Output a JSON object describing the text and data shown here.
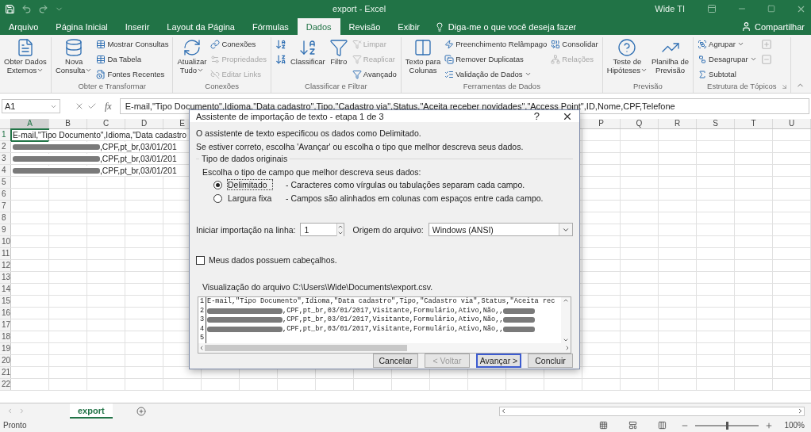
{
  "window": {
    "title": "export - Excel",
    "user": "Wide TI"
  },
  "menu_tabs": [
    {
      "label": "Arquivo",
      "selected": false
    },
    {
      "label": "Página Inicial",
      "selected": false
    },
    {
      "label": "Inserir",
      "selected": false
    },
    {
      "label": "Layout da Página",
      "selected": false
    },
    {
      "label": "Fórmulas",
      "selected": false
    },
    {
      "label": "Dados",
      "selected": true
    },
    {
      "label": "Revisão",
      "selected": false
    },
    {
      "label": "Exibir",
      "selected": false
    }
  ],
  "tell_me": "Diga-me o que você deseja fazer",
  "share": "Compartilhar",
  "ribbon_groups": [
    {
      "columns": [
        [
          {
            "kind": "large",
            "lines": [
              "Obter Dados",
              "Externos"
            ],
            "dropdown": true,
            "disabled": false
          }
        ]
      ]
    },
    {
      "label": "Obter e Transformar",
      "columns": [
        [
          {
            "kind": "large",
            "lines": [
              "Nova",
              "Consulta"
            ],
            "dropdown": true,
            "disabled": false
          }
        ],
        [
          {
            "kind": "small",
            "lines": [
              "Mostrar Consultas"
            ],
            "dropdown": false,
            "disabled": false
          },
          {
            "kind": "small",
            "lines": [
              "Da Tabela"
            ],
            "dropdown": false,
            "disabled": false
          },
          {
            "kind": "small",
            "lines": [
              "Fontes Recentes"
            ],
            "dropdown": false,
            "disabled": false
          }
        ]
      ]
    },
    {
      "label": "Conexões",
      "columns": [
        [
          {
            "kind": "large",
            "lines": [
              "Atualizar",
              "Tudo"
            ],
            "dropdown": true,
            "disabled": false
          }
        ],
        [
          {
            "kind": "small",
            "lines": [
              "Conexões"
            ],
            "dropdown": false,
            "disabled": false
          },
          {
            "kind": "small",
            "lines": [
              "Propriedades"
            ],
            "dropdown": false,
            "disabled": true
          },
          {
            "kind": "small",
            "lines": [
              "Editar Links"
            ],
            "dropdown": false,
            "disabled": true
          }
        ]
      ]
    },
    {
      "label": "Classificar e Filtrar",
      "columns": [
        [
          {
            "kind": "icon",
            "disabled": false
          },
          {
            "kind": "icon",
            "disabled": false
          }
        ],
        [
          {
            "kind": "large",
            "lines": [
              "Classificar"
            ],
            "dropdown": false,
            "disabled": false
          }
        ],
        [
          {
            "kind": "large",
            "lines": [
              "Filtro"
            ],
            "dropdown": false,
            "disabled": false
          }
        ],
        [
          {
            "kind": "small",
            "lines": [
              "Limpar"
            ],
            "dropdown": false,
            "disabled": true
          },
          {
            "kind": "small",
            "lines": [
              "Reaplicar"
            ],
            "dropdown": false,
            "disabled": true
          },
          {
            "kind": "small",
            "lines": [
              "Avançado"
            ],
            "dropdown": false,
            "disabled": false
          }
        ]
      ]
    },
    {
      "label": "Ferramentas de Dados",
      "columns": [
        [
          {
            "kind": "large",
            "lines": [
              "Texto para",
              "Colunas"
            ],
            "dropdown": false,
            "disabled": false
          }
        ],
        [
          {
            "kind": "small",
            "lines": [
              "Preenchimento Relâmpago"
            ],
            "dropdown": false,
            "disabled": false
          },
          {
            "kind": "small",
            "lines": [
              "Remover Duplicatas"
            ],
            "dropdown": false,
            "disabled": false
          },
          {
            "kind": "small",
            "lines": [
              "Validação de Dados"
            ],
            "dropdown": true,
            "disabled": false
          }
        ],
        [
          {
            "kind": "small",
            "lines": [
              "Consolidar"
            ],
            "dropdown": false,
            "disabled": false
          },
          {
            "kind": "small",
            "lines": [
              "Relações"
            ],
            "dropdown": false,
            "disabled": true
          }
        ]
      ]
    },
    {
      "label": "Previsão",
      "columns": [
        [
          {
            "kind": "large",
            "lines": [
              "Teste de",
              "Hipóteses"
            ],
            "dropdown": true,
            "disabled": false
          }
        ],
        [
          {
            "kind": "large",
            "lines": [
              "Planilha de",
              "Previsão"
            ],
            "dropdown": false,
            "disabled": false
          }
        ]
      ]
    },
    {
      "label": "Estrutura de Tópicos",
      "launcher": true,
      "columns": [
        [
          {
            "kind": "small",
            "lines": [
              "Agrupar"
            ],
            "dropdown": true,
            "disabled": false
          },
          {
            "kind": "small",
            "lines": [
              "Desagrupar"
            ],
            "dropdown": true,
            "disabled": false
          },
          {
            "kind": "small",
            "lines": [
              "Subtotal"
            ],
            "dropdown": false,
            "disabled": false
          }
        ],
        [
          {
            "kind": "icon",
            "disabled": true
          },
          {
            "kind": "icon",
            "disabled": true
          }
        ]
      ]
    }
  ],
  "formula_bar": {
    "name_box": "A1",
    "function_label": "fx",
    "formula": "E-mail,\"Tipo Documento\",Idioma,\"Data cadastro\",Tipo,\"Cadastro via\",Status,\"Aceita receber novidades\",\"Access Point\",ID,Nome,CPF,Telefone"
  },
  "sheet": {
    "columns_left": [
      "A",
      "B",
      "C",
      "D",
      "E"
    ],
    "columns_right": [
      "P",
      "Q",
      "R",
      "S",
      "T",
      "U"
    ],
    "row_numbers": [
      "1",
      "2",
      "3",
      "4",
      "5",
      "6",
      "7",
      "8",
      "9",
      "10",
      "11",
      "12",
      "13",
      "14",
      "15",
      "16",
      "17",
      "18",
      "19",
      "20",
      "21",
      "22"
    ],
    "rows": [
      {
        "text": "E-mail,\"Tipo Documento\",Idioma,\"Data cadastro",
        "selected": true
      },
      {
        "redacted": true,
        "text": ",CPF,pt_br,03/01/201",
        "selected": false
      },
      {
        "redacted": true,
        "text": ",CPF,pt_br,03/01/201",
        "selected": false
      },
      {
        "redacted": true,
        "text": ",CPF,pt_br,03/01/201",
        "selected": false
      }
    ]
  },
  "dialog": {
    "title": "Assistente de importação de texto - etapa 1 de 3",
    "help": "?",
    "intro": [
      "O assistente de texto especificou os dados como Delimitado.",
      "Se estiver correto, escolha 'Avançar' ou escolha o tipo que melhor descreva seus dados."
    ],
    "group_label": "Tipo de dados originais",
    "choose_label": "Escolha o tipo de campo que melhor descreva seus dados:",
    "options": [
      {
        "label": "Delimitado",
        "description": "- Caracteres como vírgulas ou tabulações separam cada campo.",
        "selected": true
      },
      {
        "label": "Largura fixa",
        "description": "- Campos são alinhados em colunas com espaços entre cada campo.",
        "selected": false
      }
    ],
    "start_row_label": "Iniciar importação na linha:",
    "start_row": "1",
    "origin_label": "Origem do arquivo:",
    "origin": "Windows (ANSI)",
    "headers_checkbox": {
      "label": "Meus dados possuem cabeçalhos.",
      "checked": false
    },
    "preview_label": "Visualização do arquivo C:\\Users\\Wide\\Documents\\export.csv.",
    "preview_lines": [
      {
        "number": "1",
        "text": "E-mail,\"Tipo Documento\",Idioma,\"Data cadastro\",Tipo,\"Cadastro via\",Status,\"Aceita rec"
      },
      {
        "number": "2",
        "redacted": true,
        "text": ",CPF,pt_br,03/01/2017,Visitante,Formulário,Ativo,Não,,"
      },
      {
        "number": "3",
        "redacted": true,
        "text": ",CPF,pt_br,03/01/2017,Visitante,Formulário,Ativo,Não,,"
      },
      {
        "number": "4",
        "redacted": true,
        "text": ",CPF,pt_br,03/01/2017,Visitante,Formulário,Ativo,Não,,"
      },
      {
        "number": "5"
      }
    ],
    "buttons": [
      {
        "label": "Cancelar",
        "disabled": false,
        "default": false
      },
      {
        "label": "< Voltar",
        "disabled": true,
        "default": false
      },
      {
        "label": "Avançar >",
        "disabled": false,
        "default": true
      },
      {
        "label": "Concluir",
        "disabled": false,
        "default": false
      }
    ]
  },
  "sheet_tabs": [
    {
      "label": "export",
      "selected": true
    }
  ],
  "status_bar": {
    "status": "Pronto",
    "zoom": "100%",
    "zoom_slider": {
      "level": 0.5
    }
  }
}
